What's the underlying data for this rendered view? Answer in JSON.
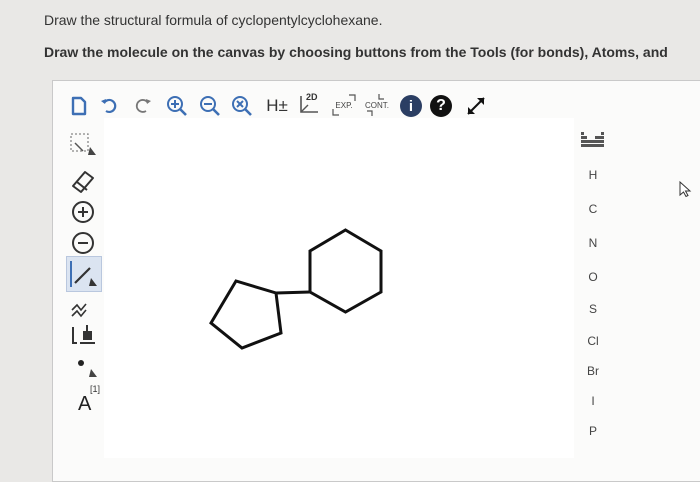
{
  "question": {
    "line1": "Draw the structural formula of cyclopentylcyclohexane.",
    "line2": "Draw the molecule on the canvas by choosing buttons from the Tools (for bonds), Atoms, and"
  },
  "toolbar": {
    "h_label": "H±",
    "twod_label": "2D",
    "exp_label": "EXP.",
    "cont_label": "CONT.",
    "info_label": "i",
    "help_label": "?"
  },
  "tools": {
    "charge_label": "A",
    "charge_superscript": "[1]"
  },
  "atoms": [
    "H",
    "C",
    "N",
    "O",
    "S",
    "Cl",
    "Br",
    "I",
    "P"
  ],
  "colors": {
    "background": "#e9e8e6",
    "accent": "#3d6fb4",
    "highlight": "#dbe4f1"
  },
  "icons": {
    "new": "new-document-icon",
    "undo": "undo-icon",
    "redo": "redo-icon",
    "zoom_in": "zoom-in-icon",
    "zoom_out": "zoom-out-icon",
    "zoom_reset": "zoom-reset-icon",
    "fullscreen": "expand-icon",
    "eraser": "eraser-icon",
    "periodic": "periodic-table-icon"
  }
}
